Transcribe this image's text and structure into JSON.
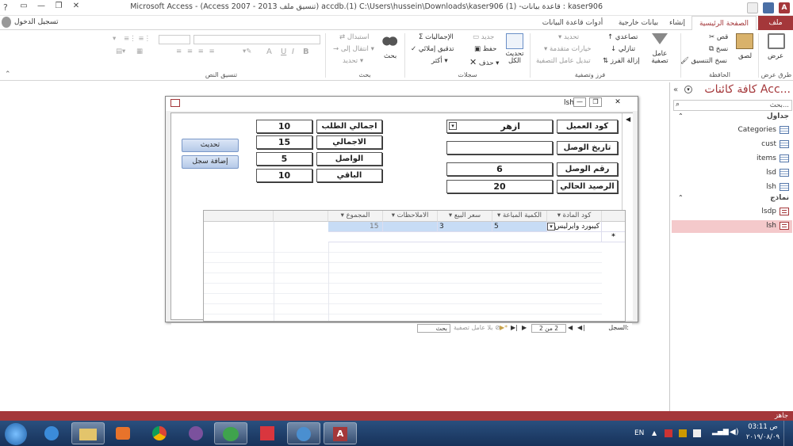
{
  "window": {
    "title": "kaser906 : قاعدة بيانات- (1) accdb.(1) C:\\Users\\hussein\\Downloads\\kaser906 (تنسيق ملف Access 2007 - 2013) - Microsoft Access",
    "login": "تسجيل الدخول",
    "help": "?"
  },
  "tabs": [
    "ملف",
    "الصفحة الرئيسية",
    "إنشاء",
    "بيانات خارجية",
    "أدوات قاعدة البيانات"
  ],
  "ribbon": {
    "views": {
      "label": "عرض",
      "group": "طرق عرض"
    },
    "clipboard": {
      "paste": "لصق",
      "cut": "قص",
      "copy": "نسخ",
      "format_painter": "نسخ التنسيق",
      "group": "الحافظة"
    },
    "sort_filter": {
      "filter": "عامل تصفية",
      "ascending": "تصاعدي",
      "descending": "تنازلي",
      "remove_sort": "إزالة الفرز",
      "selection": "تحديد",
      "advanced": "خيارات متقدمة",
      "toggle": "تبديل عامل التصفية",
      "group": "فرز وتصفية"
    },
    "records": {
      "refresh": "تحديث الكل",
      "new": "جديد",
      "save": "حفظ",
      "delete": "حذف",
      "totals": "الإجماليات",
      "spelling": "تدقيق إملائي",
      "more": "أكثر",
      "group": "سجلات"
    },
    "find": {
      "find": "بحث",
      "replace": "استبدال",
      "goto": "انتقال إلى",
      "select": "تحديد",
      "group": "بحث"
    },
    "text_format": {
      "group": "تنسيق النص",
      "bold": "B",
      "italic": "I",
      "underline": "U",
      "font_color": "A"
    }
  },
  "nav": {
    "title": "كافة كائنات Acc...",
    "search_placeholder": "بحث...",
    "sections": [
      {
        "name": "جداول",
        "items": [
          "Categories",
          "cust",
          "items",
          "lsd",
          "lsh"
        ]
      },
      {
        "name": "نماذج",
        "items": [
          "lsdp",
          "lsh"
        ]
      }
    ],
    "selected": "lsh"
  },
  "form": {
    "title": "lsh",
    "customer_code_label": "كود العميل",
    "customer_code_value": "ازهر",
    "arrival_date_label": "تاريخ الوصل",
    "arrival_date_value": "",
    "receipt_no_label": "رقم الوصل",
    "receipt_no_value": "6",
    "balance_label": "الرصيد الحالي",
    "balance_value": "20",
    "order_total_label": "اجمالي الطلب",
    "order_total_value": "10",
    "total_label": "الاجمالي",
    "total_value": "15",
    "received_label": "الواصل",
    "received_value": "5",
    "remaining_label": "الباقي",
    "remaining_value": "10",
    "refresh_button": "تحديث",
    "add_record_button": "إضافة سجل"
  },
  "grid": {
    "columns": [
      "كود المادة",
      "الكمية المباعة",
      "سعر البيع",
      "الاملاحظات",
      "المجموع"
    ],
    "rows": [
      [
        "كيبورد وايرليس",
        "5",
        "3",
        "",
        "15"
      ]
    ],
    "new_row_marker": "*"
  },
  "record_nav": {
    "label": "السجل:",
    "position": "2 من 2",
    "filter": "بلا عامل تصفية",
    "search": "بحث"
  },
  "status": {
    "text": "جاهز"
  },
  "taskbar": {
    "lang": "EN",
    "time": "03:11 ص",
    "date": "٢٠١٩/٠٨/٠٩"
  },
  "colors": {
    "accent": "#a4373a",
    "nav_selected": "#f4c9cb",
    "row_highlight": "#c7dcf5"
  }
}
